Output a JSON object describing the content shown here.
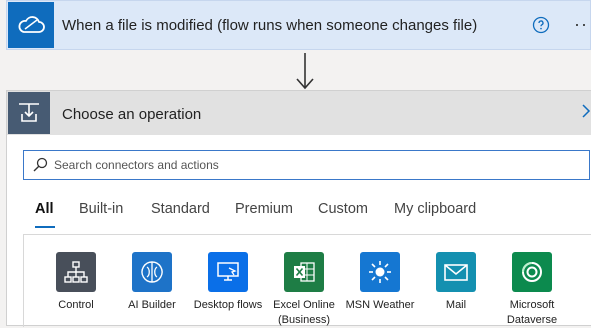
{
  "trigger": {
    "title": "When a file is modified (flow runs when someone changes file)",
    "icon": "onedrive-cloud-icon",
    "help_icon": "help-circle-icon",
    "more_label": "··"
  },
  "operation": {
    "title": "Choose an operation",
    "icon": "operation-icon"
  },
  "search": {
    "placeholder": "Search connectors and actions",
    "value": ""
  },
  "tabs": [
    {
      "label": "All",
      "active": true
    },
    {
      "label": "Built-in",
      "active": false
    },
    {
      "label": "Standard",
      "active": false
    },
    {
      "label": "Premium",
      "active": false
    },
    {
      "label": "Custom",
      "active": false
    },
    {
      "label": "My clipboard",
      "active": false
    }
  ],
  "connectors": [
    {
      "label": "Control",
      "color": "#484f5a",
      "icon": "control-icon"
    },
    {
      "label": "AI Builder",
      "color": "#1e73c8",
      "icon": "ai-builder-icon"
    },
    {
      "label": "Desktop flows",
      "color": "#0a6fe8",
      "icon": "desktop-flows-icon"
    },
    {
      "label": "Excel Online (Business)",
      "color": "#1e7d45",
      "icon": "excel-icon"
    },
    {
      "label": "MSN Weather",
      "color": "#1577d2",
      "icon": "weather-icon"
    },
    {
      "label": "Mail",
      "color": "#1490b0",
      "icon": "mail-icon"
    },
    {
      "label": "Microsoft Dataverse",
      "color": "#0c8a4e",
      "icon": "dataverse-icon"
    }
  ],
  "colors": {
    "accent": "#0f6cbd",
    "trigger_bg": "#dce8f8",
    "header_bg": "#e1e1e1"
  }
}
